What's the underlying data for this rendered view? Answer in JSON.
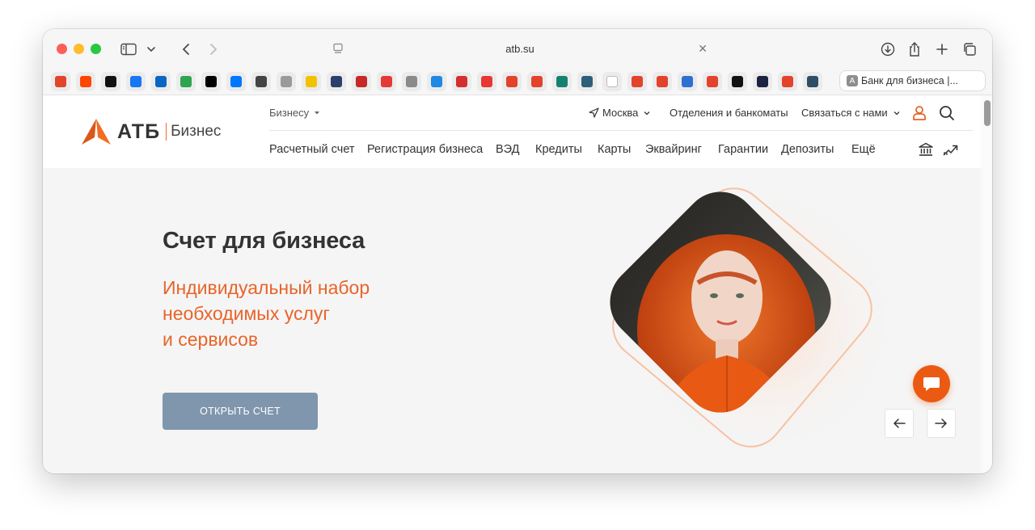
{
  "browser": {
    "address": "atb.su",
    "tab_title": "Банк для бизнеса |...",
    "tab_favicon_letter": "A",
    "favorites": [
      {
        "icon": "gitlab-icon",
        "color": "#e2432a"
      },
      {
        "icon": "reddit-icon",
        "color": "#ff4500"
      },
      {
        "icon": "threads-icon",
        "color": "#111111"
      },
      {
        "icon": "facebook-icon",
        "color": "#1877f2"
      },
      {
        "icon": "linkedin-icon",
        "color": "#0a66c2"
      },
      {
        "icon": "green-app-icon",
        "color": "#2ea44f"
      },
      {
        "icon": "x-icon",
        "color": "#000000"
      },
      {
        "icon": "vk-icon",
        "color": "#0077ff"
      },
      {
        "icon": "globe-icon",
        "color": "#444444"
      },
      {
        "icon": "compass-icon",
        "color": "#9a9a9a"
      },
      {
        "icon": "yellow-app-icon",
        "color": "#f2c200"
      },
      {
        "icon": "gear-app-icon",
        "color": "#2b3f6b"
      },
      {
        "icon": "red-download-icon",
        "color": "#c62828"
      },
      {
        "icon": "p-icon",
        "color": "#e53935"
      },
      {
        "icon": "one-icon",
        "color": "#8a8a8a"
      },
      {
        "icon": "rainbow-icon",
        "color": "#1e88e5"
      },
      {
        "icon": "sb-icon",
        "color": "#d32f2f"
      },
      {
        "icon": "microphone-icon",
        "color": "#e53935"
      },
      {
        "icon": "gitlab-icon",
        "color": "#e2432a"
      },
      {
        "icon": "gitlab-icon",
        "color": "#e2432a"
      },
      {
        "icon": "shield-app-icon",
        "color": "#16806e"
      },
      {
        "icon": "m-icon",
        "color": "#2d5f7a"
      },
      {
        "icon": "white-app-icon",
        "color": "#ffffff"
      },
      {
        "icon": "gitlab-icon",
        "color": "#e2432a"
      },
      {
        "icon": "gitlab-icon",
        "color": "#e2432a"
      },
      {
        "icon": "a-icon",
        "color": "#2f6fd1"
      },
      {
        "icon": "gitlab-icon",
        "color": "#e2432a"
      },
      {
        "icon": "triangle-icon",
        "color": "#111111"
      },
      {
        "icon": "dark-app-icon",
        "color": "#1c2340"
      },
      {
        "icon": "gitlab-icon",
        "color": "#e2432a"
      },
      {
        "icon": "grid-app-icon",
        "color": "#2d4e66"
      }
    ]
  },
  "site": {
    "logo": {
      "name": "АТБ",
      "sub": "Бизнес"
    },
    "segment": "Бизнесу",
    "city": "Москва",
    "branches": "Отделения и банкоматы",
    "contact": "Связаться с нами",
    "menu": [
      "Расчетный счет",
      "Регистрация бизнеса",
      "ВЭД",
      "Кредиты",
      "Карты",
      "Эквайринг",
      "Гарантии",
      "Депозиты",
      "Ещё"
    ],
    "hero": {
      "title": "Счет для бизнеса",
      "subtitle_lines": [
        "Индивидуальный набор",
        "необходимых услуг",
        "и сервисов"
      ],
      "cta": "ОТКРЫТЬ СЧЕТ"
    },
    "accent": "#e8642a",
    "cta_color": "#8096ad"
  }
}
